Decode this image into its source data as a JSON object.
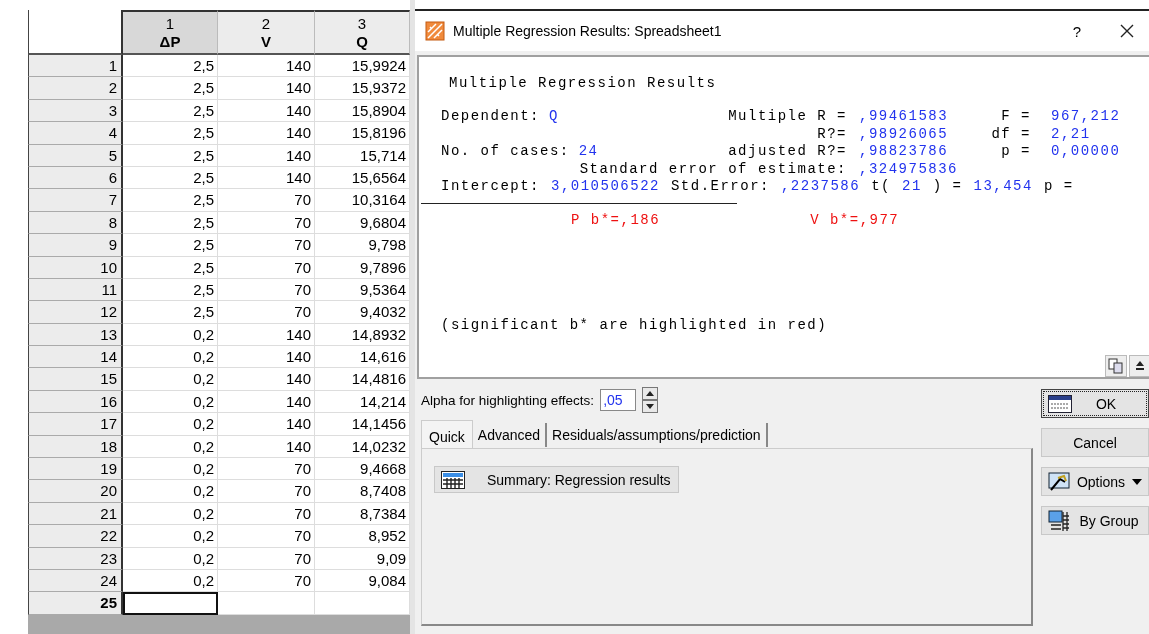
{
  "spreadsheet": {
    "columns": [
      {
        "number": "1",
        "name": "ΔP",
        "selected": true
      },
      {
        "number": "2",
        "name": "V",
        "selected": false
      },
      {
        "number": "3",
        "name": "Q",
        "selected": false
      }
    ],
    "rows": [
      {
        "header": "1",
        "cells": [
          "2,5",
          "140",
          "15,9924"
        ],
        "selected": false
      },
      {
        "header": "2",
        "cells": [
          "2,5",
          "140",
          "15,9372"
        ],
        "selected": false
      },
      {
        "header": "3",
        "cells": [
          "2,5",
          "140",
          "15,8904"
        ],
        "selected": false
      },
      {
        "header": "4",
        "cells": [
          "2,5",
          "140",
          "15,8196"
        ],
        "selected": false
      },
      {
        "header": "5",
        "cells": [
          "2,5",
          "140",
          "15,714"
        ],
        "selected": false
      },
      {
        "header": "6",
        "cells": [
          "2,5",
          "140",
          "15,6564"
        ],
        "selected": false
      },
      {
        "header": "7",
        "cells": [
          "2,5",
          "70",
          "10,3164"
        ],
        "selected": false
      },
      {
        "header": "8",
        "cells": [
          "2,5",
          "70",
          "9,6804"
        ],
        "selected": false
      },
      {
        "header": "9",
        "cells": [
          "2,5",
          "70",
          "9,798"
        ],
        "selected": false
      },
      {
        "header": "10",
        "cells": [
          "2,5",
          "70",
          "9,7896"
        ],
        "selected": false
      },
      {
        "header": "11",
        "cells": [
          "2,5",
          "70",
          "9,5364"
        ],
        "selected": false
      },
      {
        "header": "12",
        "cells": [
          "2,5",
          "70",
          "9,4032"
        ],
        "selected": false
      },
      {
        "header": "13",
        "cells": [
          "0,2",
          "140",
          "14,8932"
        ],
        "selected": false
      },
      {
        "header": "14",
        "cells": [
          "0,2",
          "140",
          "14,616"
        ],
        "selected": false
      },
      {
        "header": "15",
        "cells": [
          "0,2",
          "140",
          "14,4816"
        ],
        "selected": false
      },
      {
        "header": "16",
        "cells": [
          "0,2",
          "140",
          "14,214"
        ],
        "selected": false
      },
      {
        "header": "17",
        "cells": [
          "0,2",
          "140",
          "14,1456"
        ],
        "selected": false
      },
      {
        "header": "18",
        "cells": [
          "0,2",
          "140",
          "14,0232"
        ],
        "selected": false
      },
      {
        "header": "19",
        "cells": [
          "0,2",
          "70",
          "9,4668"
        ],
        "selected": false
      },
      {
        "header": "20",
        "cells": [
          "0,2",
          "70",
          "8,7408"
        ],
        "selected": false
      },
      {
        "header": "21",
        "cells": [
          "0,2",
          "70",
          "8,7384"
        ],
        "selected": false
      },
      {
        "header": "22",
        "cells": [
          "0,2",
          "70",
          "8,952"
        ],
        "selected": false
      },
      {
        "header": "23",
        "cells": [
          "0,2",
          "70",
          "9,09"
        ],
        "selected": false
      },
      {
        "header": "24",
        "cells": [
          "0,2",
          "70",
          "9,084"
        ],
        "selected": false
      },
      {
        "header": "25",
        "cells": [
          "",
          "",
          ""
        ],
        "selected": true
      }
    ]
  },
  "dialog": {
    "title": "Multiple Regression Results: Spreadsheet1",
    "help": "?",
    "output": {
      "heading": "Multiple Regression Results",
      "stats": [
        {
          "a_label": "Dependent:",
          "a_value": "Q",
          "b_label": "Multiple R =",
          "b_value": ",99461583",
          "c_label": "F =",
          "c_value": "967,212"
        },
        {
          "b_label": "R?=",
          "b_value": ",98926065",
          "c_label": "df =",
          "c_value": "2,21"
        },
        {
          "a_label": "No. of cases:",
          "a_value": "24",
          "b_label": "adjusted R?=",
          "b_value": ",98823786",
          "c_label": "p =",
          "c_value": "0,00000"
        },
        {
          "b_label": "Standard error of estimate:",
          "b_value": ",324975836"
        }
      ],
      "intercept": [
        {
          "kind": "label",
          "text": "Intercept:"
        },
        {
          "kind": "value",
          "text": "3,010506522"
        },
        {
          "kind": "label",
          "text": "Std.Error:"
        },
        {
          "kind": "value",
          "text": ",2237586"
        },
        {
          "kind": "label",
          "text": "t("
        },
        {
          "kind": "value",
          "text": "21"
        },
        {
          "kind": "label",
          "text": ") ="
        },
        {
          "kind": "value",
          "text": "13,454"
        },
        {
          "kind": "label",
          "text": "p ="
        }
      ],
      "coefficients": [
        "P b*=,186",
        "V b*=,977"
      ],
      "note": "(significant b* are highlighted in red)"
    },
    "alpha": {
      "label": "Alpha for highlighting effects:",
      "value": ",05"
    },
    "tabs": [
      {
        "label": "Quick",
        "selected": true
      },
      {
        "label": "Advanced",
        "selected": false
      },
      {
        "label": "Residuals/assumptions/prediction",
        "selected": false
      }
    ],
    "quick_buttons": [
      "Summary:  Regression results"
    ],
    "buttons": [
      {
        "kind": "ok",
        "label": "OK"
      },
      {
        "kind": "cancel",
        "label": "Cancel"
      },
      {
        "kind": "options",
        "label": "Options"
      },
      {
        "kind": "bygroup",
        "label": "By Group"
      }
    ]
  }
}
